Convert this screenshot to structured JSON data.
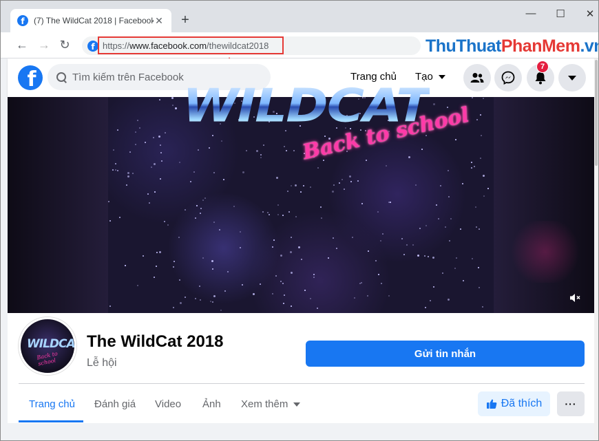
{
  "browser": {
    "tab_title": "(7) The WildCat 2018 | Facebook",
    "tab_close": "✕",
    "new_tab": "+",
    "url": {
      "scheme": "https://",
      "host": "www.facebook.com",
      "path": "/thewildcat2018"
    },
    "window_controls": {
      "minimize": "—",
      "maximize": "☐",
      "close": "✕"
    }
  },
  "watermark": {
    "part1": "ThuThuat",
    "part2": "PhanMem",
    "part3": ".vn"
  },
  "facebook": {
    "logo": "f",
    "search_placeholder": "Tìm kiếm trên Facebook",
    "nav": {
      "home": "Trang chủ",
      "create": "Tạo"
    },
    "notification_count": "7",
    "accent": "#1877f2"
  },
  "cover": {
    "title": "WILDCAT",
    "subtitle": "Back to school"
  },
  "page": {
    "name": "The WildCat 2018",
    "category": "Lễ hội",
    "message_button": "Gửi tin nhắn",
    "tabs": [
      {
        "label": "Trang chủ"
      },
      {
        "label": "Đánh giá"
      },
      {
        "label": "Video"
      },
      {
        "label": "Ảnh"
      },
      {
        "label": "Xem thêm"
      }
    ],
    "liked_button": "Đã thích",
    "more_button": "···"
  }
}
